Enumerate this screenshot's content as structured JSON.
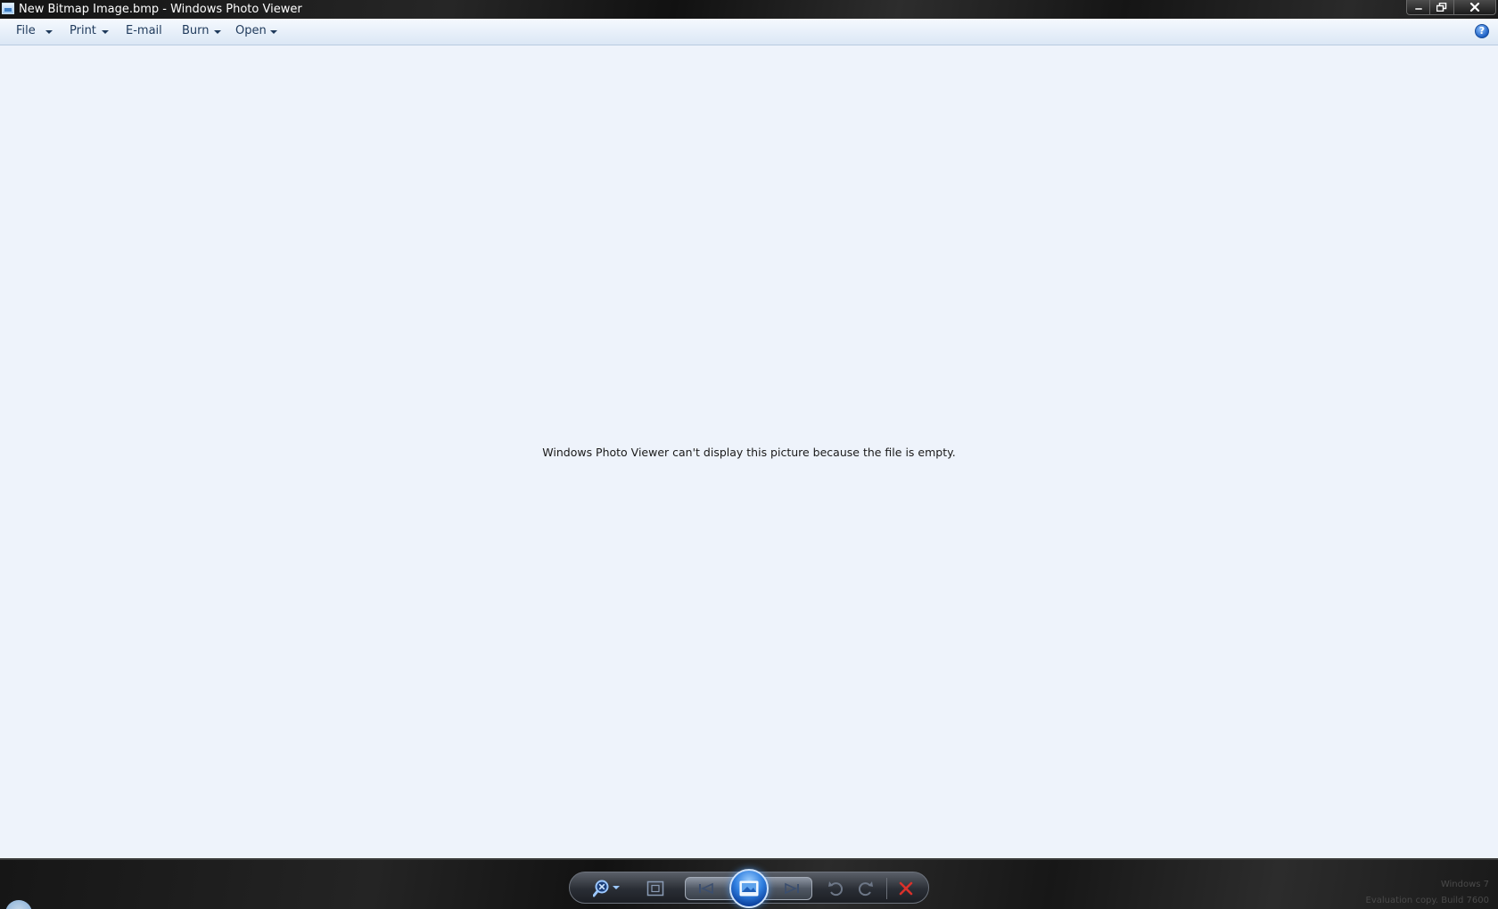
{
  "window": {
    "title": "New Bitmap Image.bmp - Windows Photo Viewer"
  },
  "menu": {
    "file": "File",
    "print": "Print",
    "email": "E-mail",
    "burn": "Burn",
    "open": "Open",
    "help_glyph": "?"
  },
  "content": {
    "message": "Windows Photo Viewer can't display this picture because the file is empty."
  },
  "controls": {
    "icons": [
      "zoom-icon",
      "actual-size-icon",
      "previous-icon",
      "slideshow-icon",
      "next-icon",
      "rotate-counterclockwise-icon",
      "rotate-clockwise-icon",
      "delete-icon"
    ],
    "colors": {
      "accent_blue": "#2f7fe0",
      "delete_red": "#d9312b"
    }
  },
  "watermark": {
    "line1": "Windows 7",
    "line2": "Evaluation copy. Build 7600"
  }
}
